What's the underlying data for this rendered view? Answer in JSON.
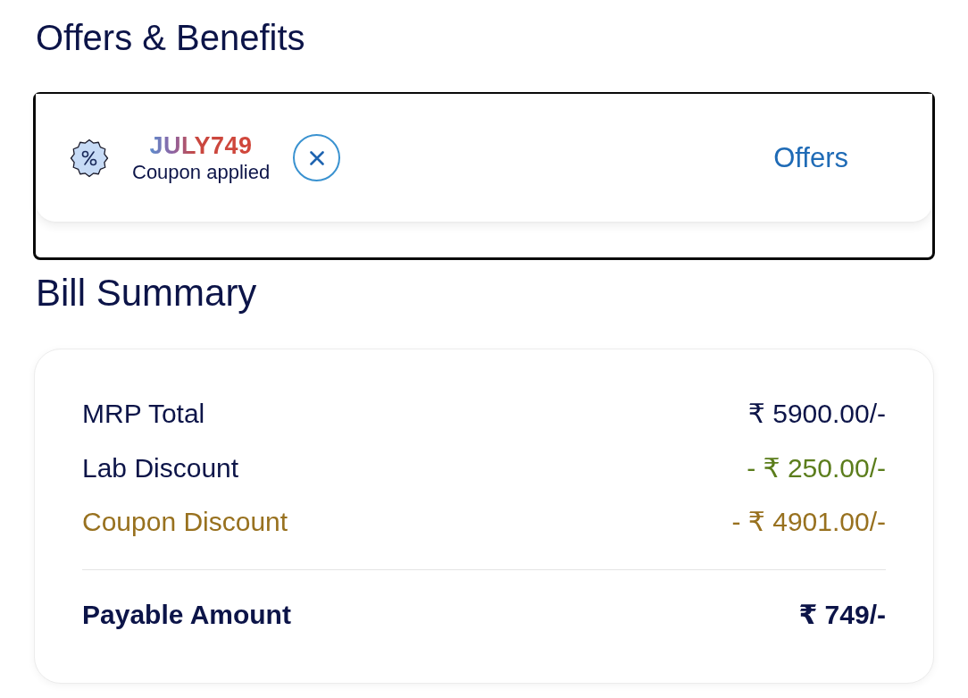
{
  "offers_section": {
    "title": "Offers & Benefits",
    "coupon": {
      "code": "JULY749",
      "status": "Coupon applied"
    },
    "offers_link": "Offers"
  },
  "bill_summary": {
    "title": "Bill Summary",
    "rows": [
      {
        "label": "MRP Total",
        "value": "₹ 5900.00/-",
        "kind": "charge"
      },
      {
        "label": "Lab Discount",
        "value": "- ₹ 250.00/-",
        "kind": "lab_discount"
      },
      {
        "label": "Coupon Discount",
        "value": "- ₹ 4901.00/-",
        "kind": "coupon_discount"
      }
    ],
    "total": {
      "label": "Payable Amount",
      "value": "₹ 749/-"
    }
  }
}
